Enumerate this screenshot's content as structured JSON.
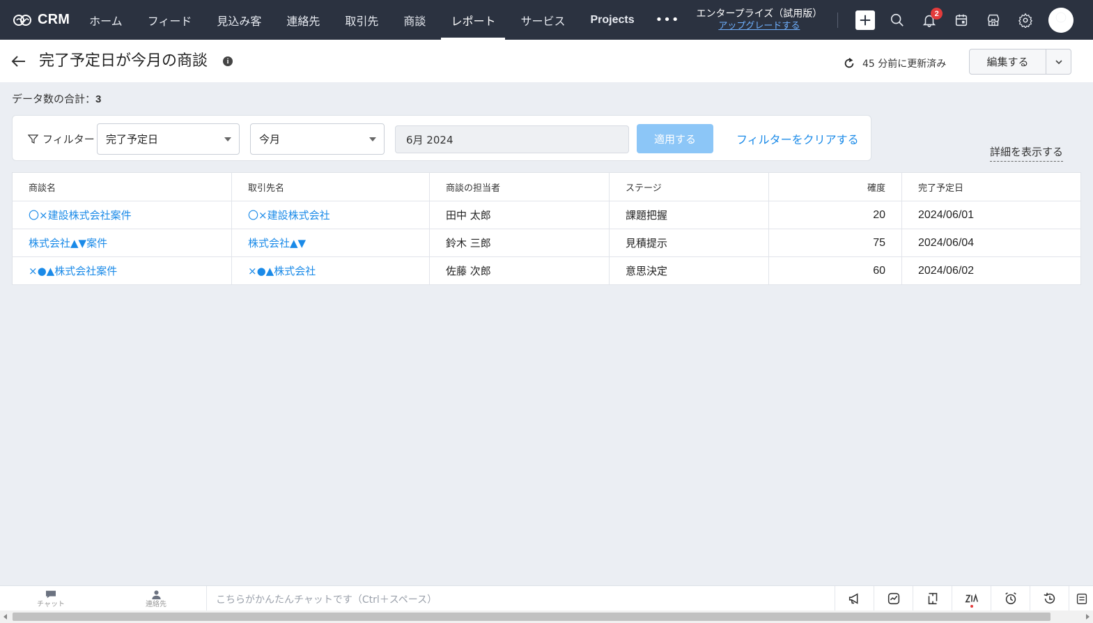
{
  "app": {
    "brand": "CRM"
  },
  "nav": {
    "tabs": [
      {
        "label": "ホーム"
      },
      {
        "label": "フィード"
      },
      {
        "label": "見込み客"
      },
      {
        "label": "連絡先"
      },
      {
        "label": "取引先"
      },
      {
        "label": "商談"
      },
      {
        "label": "レポート",
        "active": true
      },
      {
        "label": "サービス"
      },
      {
        "label": "Projects"
      }
    ],
    "more": "•••",
    "edition_title": "エンタープライズ（試用版）",
    "edition_upgrade": "アップグレードする",
    "notification_count": "2",
    "icons": [
      "plus-icon",
      "search-icon",
      "bell-icon",
      "calendar-icon",
      "marketplace-icon",
      "gear-icon",
      "avatar"
    ]
  },
  "header": {
    "title": "完了予定日が今月の商談",
    "info": "i",
    "refresh_text": "45 分前に更新済み",
    "edit_label": "編集する"
  },
  "summary": {
    "label": "データ数の合計：",
    "value": "3"
  },
  "filter": {
    "label": "フィルター",
    "field": "完了予定日",
    "period": "今月",
    "date_value": "6月 2024",
    "apply_label": "適用する",
    "clear_label": "フィルターをクリアする",
    "details_label": "詳細を表示する"
  },
  "table": {
    "headers": [
      "商談名",
      "取引先名",
      "商談の担当者",
      "ステージ",
      "確度",
      "完了予定日"
    ],
    "rows": [
      [
        "〇×建設株式会社案件",
        "〇×建設株式会社",
        "田中 太郎",
        "課題把握",
        "20",
        "2024/06/01"
      ],
      [
        "株式会社▲▼案件",
        "株式会社▲▼",
        "鈴木 三郎",
        "見積提示",
        "75",
        "2024/06/04"
      ],
      [
        "×●▲株式会社案件",
        "×●▲株式会社",
        "佐藤 次郎",
        "意思決定",
        "60",
        "2024/06/02"
      ]
    ]
  },
  "bottombar": {
    "chat_label": "チャット",
    "contacts_label": "連絡先",
    "chat_placeholder": "こちらがかんたんチャットです（Ctrl＋スペース）",
    "icons": [
      "megaphone-icon",
      "activity-icon",
      "share-icon",
      "zia-icon",
      "alarm-icon",
      "history-icon",
      "notes-icon"
    ]
  },
  "colors": {
    "nav_bg": "#2b3240",
    "link": "#1a8ae8",
    "apply_button": "#8cc6f7",
    "badge": "#e33b3b",
    "page_bg": "#ebeef3"
  }
}
